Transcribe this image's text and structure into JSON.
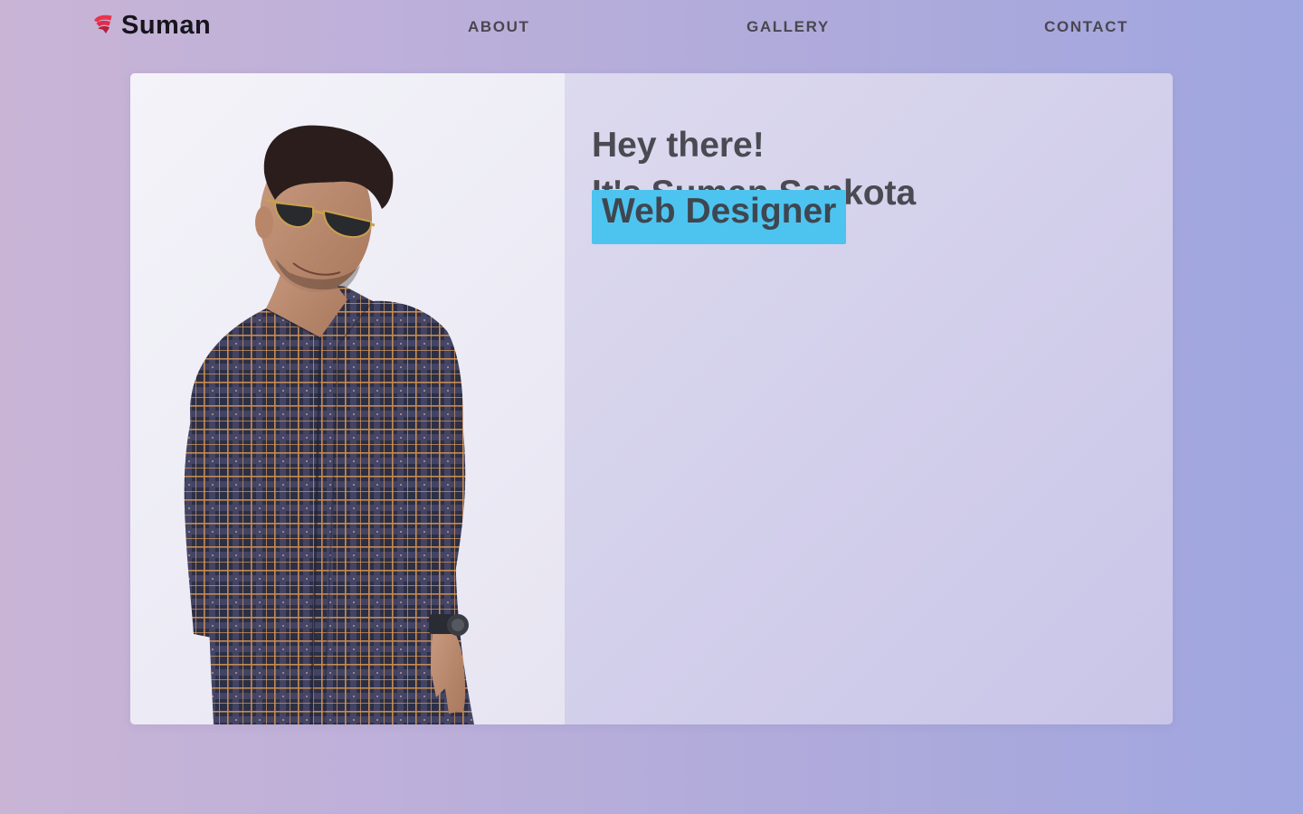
{
  "nav": {
    "brand": "Suman",
    "links": [
      "ABOUT",
      "GALLERY",
      "CONTACT"
    ]
  },
  "hero": {
    "greeting": "Hey there!",
    "intro": "It's Suman Sapkota",
    "role": "Web Designer"
  },
  "colors": {
    "badge": "#4dc4f0",
    "heading_text": "#4a4a52",
    "nav_text": "#4a4650",
    "brand_text": "#16151c",
    "logo_red": "#e8344e"
  },
  "icons": [
    "brand-logo-icon"
  ]
}
